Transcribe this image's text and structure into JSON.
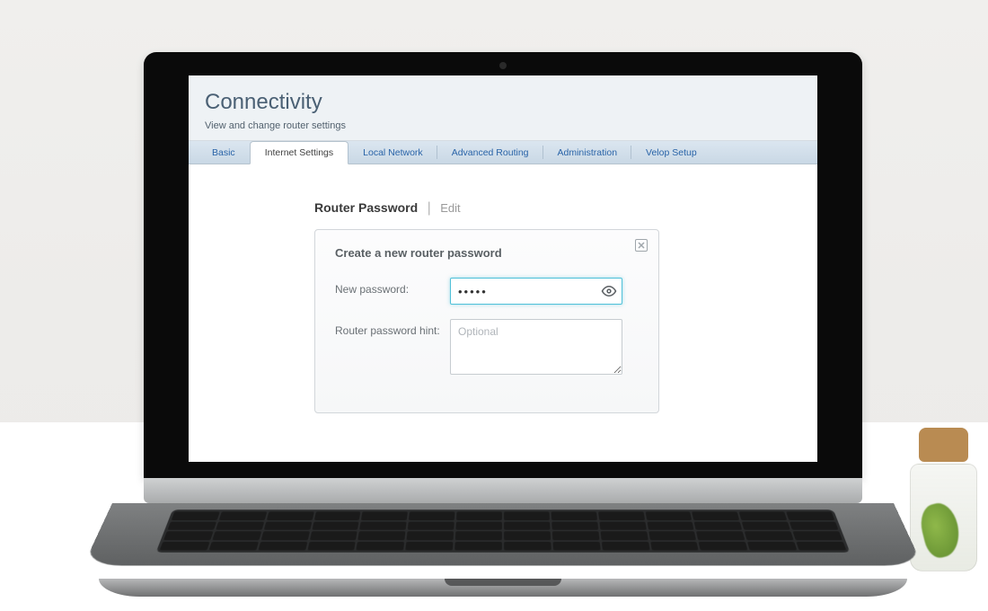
{
  "page": {
    "title": "Connectivity",
    "subtitle": "View and change router settings"
  },
  "tabs": {
    "items": [
      "Basic",
      "Internet Settings",
      "Local Network",
      "Advanced Routing",
      "Administration",
      "Velop Setup"
    ],
    "active_index": 1
  },
  "section": {
    "title": "Router Password",
    "edit": "Edit"
  },
  "panel": {
    "title": "Create a new router password",
    "labels": {
      "new_password": "New password:",
      "hint": "Router password hint:"
    },
    "fields": {
      "password_value": "•••••",
      "hint_placeholder": "Optional",
      "hint_value": ""
    }
  }
}
